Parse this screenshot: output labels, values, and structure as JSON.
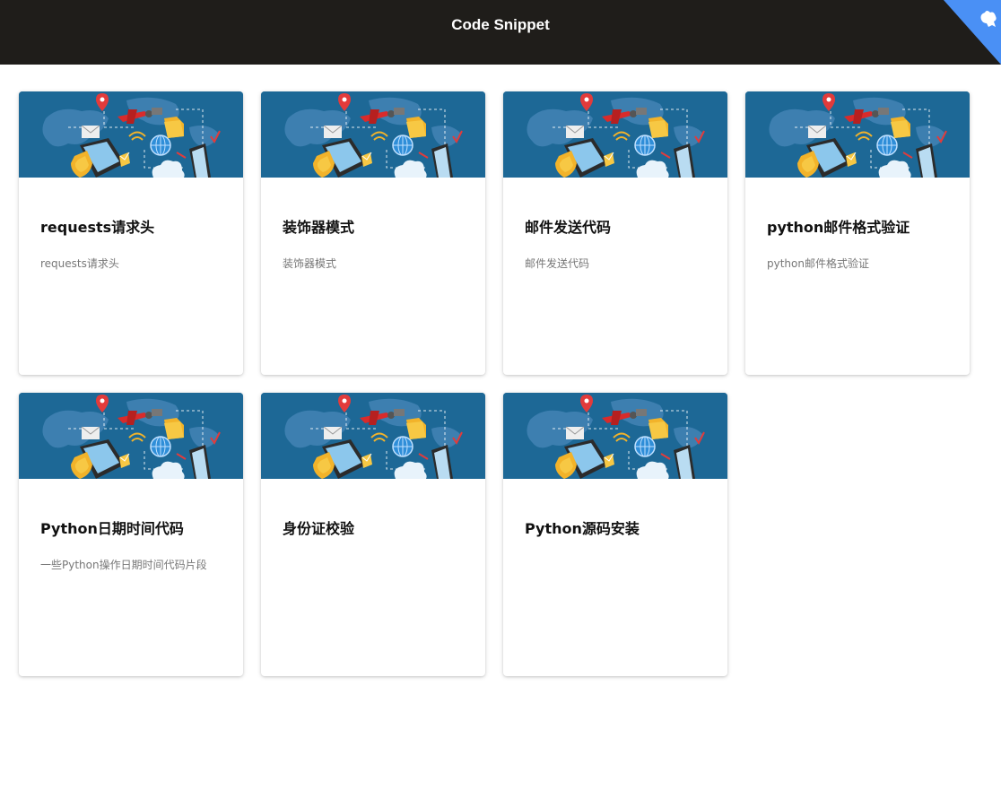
{
  "header": {
    "title": "Code Snippet"
  },
  "colors": {
    "header_bg": "#1f1d1a",
    "corner_badge": "#4a90f5",
    "card_image_bg": "#1d6896"
  },
  "cards": [
    {
      "title": "requests请求头",
      "description": "requests请求头"
    },
    {
      "title": "装饰器模式",
      "description": "装饰器模式"
    },
    {
      "title": "邮件发送代码",
      "description": "邮件发送代码"
    },
    {
      "title": "python邮件格式验证",
      "description": "python邮件格式验证"
    },
    {
      "title": "Python日期时间代码",
      "description": "一些Python操作日期时间代码片段"
    },
    {
      "title": "身份证校验",
      "description": ""
    },
    {
      "title": "Python源码安装",
      "description": ""
    }
  ]
}
